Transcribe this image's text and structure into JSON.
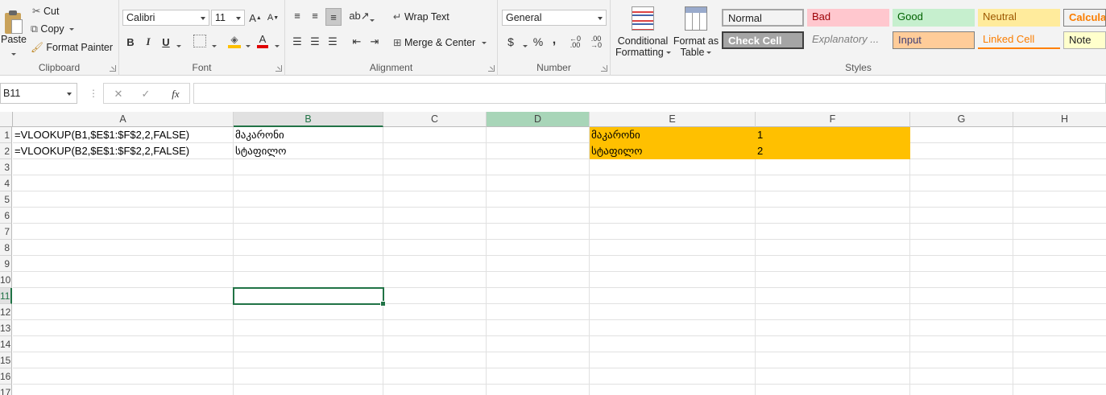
{
  "ribbon": {
    "clipboard": {
      "paste": "Paste",
      "cut": "Cut",
      "copy": "Copy",
      "format_painter": "Format Painter",
      "label": "Clipboard"
    },
    "font": {
      "name": "Calibri",
      "size": "11",
      "bold": "B",
      "italic": "I",
      "underline": "U",
      "font_color_letter": "A",
      "label": "Font"
    },
    "alignment": {
      "wrap_text": "Wrap Text",
      "merge_center": "Merge & Center",
      "label": "Alignment"
    },
    "number": {
      "format": "General",
      "currency": "$",
      "percent": "%",
      "comma": ",",
      "label": "Number"
    },
    "styles": {
      "conditional_1": "Conditional",
      "conditional_2": "Formatting",
      "format_as_1": "Format as",
      "format_as_2": "Table",
      "label": "Styles",
      "gallery": [
        {
          "label": "Normal",
          "bg": "#ffffff",
          "fg": "#000000",
          "border": "#a6a6a6"
        },
        {
          "label": "Bad",
          "bg": "#ffc7ce",
          "fg": "#9c0006",
          "border": "#ffc7ce"
        },
        {
          "label": "Good",
          "bg": "#c6efce",
          "fg": "#006100",
          "border": "#c6efce"
        },
        {
          "label": "Neutral",
          "bg": "#ffeb9c",
          "fg": "#9c5700",
          "border": "#ffeb9c"
        },
        {
          "label": "Calculat",
          "bg": "#f2f2f2",
          "fg": "#fa7d00",
          "border": "#7f7f7f"
        },
        {
          "label": "Check Cell",
          "bg": "#a5a5a5",
          "fg": "#ffffff",
          "border": "#3f3f3f"
        },
        {
          "label": "Explanatory ...",
          "bg": "#ffffff",
          "fg": "#7f7f7f",
          "border": "#ffffff"
        },
        {
          "label": "Input",
          "bg": "#ffcc99",
          "fg": "#3f3f76",
          "border": "#7f7f7f"
        },
        {
          "label": "Linked Cell",
          "bg": "#ffffff",
          "fg": "#fa7d00",
          "border": "#ffffff"
        },
        {
          "label": "Note",
          "bg": "#ffffcc",
          "fg": "#000000",
          "border": "#b2b2b2"
        }
      ]
    }
  },
  "formula_bar": {
    "name_box": "B11",
    "cancel": "✕",
    "enter": "✓",
    "fx": "fx",
    "formula": ""
  },
  "sheet": {
    "columns": [
      "A",
      "B",
      "C",
      "D",
      "E",
      "F",
      "G",
      "H"
    ],
    "rows": [
      "1",
      "2",
      "3",
      "4",
      "5",
      "6",
      "7",
      "8",
      "9",
      "10",
      "11",
      "12",
      "13",
      "14",
      "15",
      "16",
      "17"
    ],
    "cells": {
      "A1": "=VLOOKUP(B1,$E$1:$F$2,2,FALSE)",
      "A2": "=VLOOKUP(B2,$E$1:$F$2,2,FALSE)",
      "B1": "მაკარონი",
      "B2": "სტაფილო",
      "E1": "მაკარონი",
      "E2": "სტაფილო",
      "F1": "1",
      "F2": "2"
    },
    "selected_cell": "B11",
    "highlight_color": "#ffc000"
  }
}
